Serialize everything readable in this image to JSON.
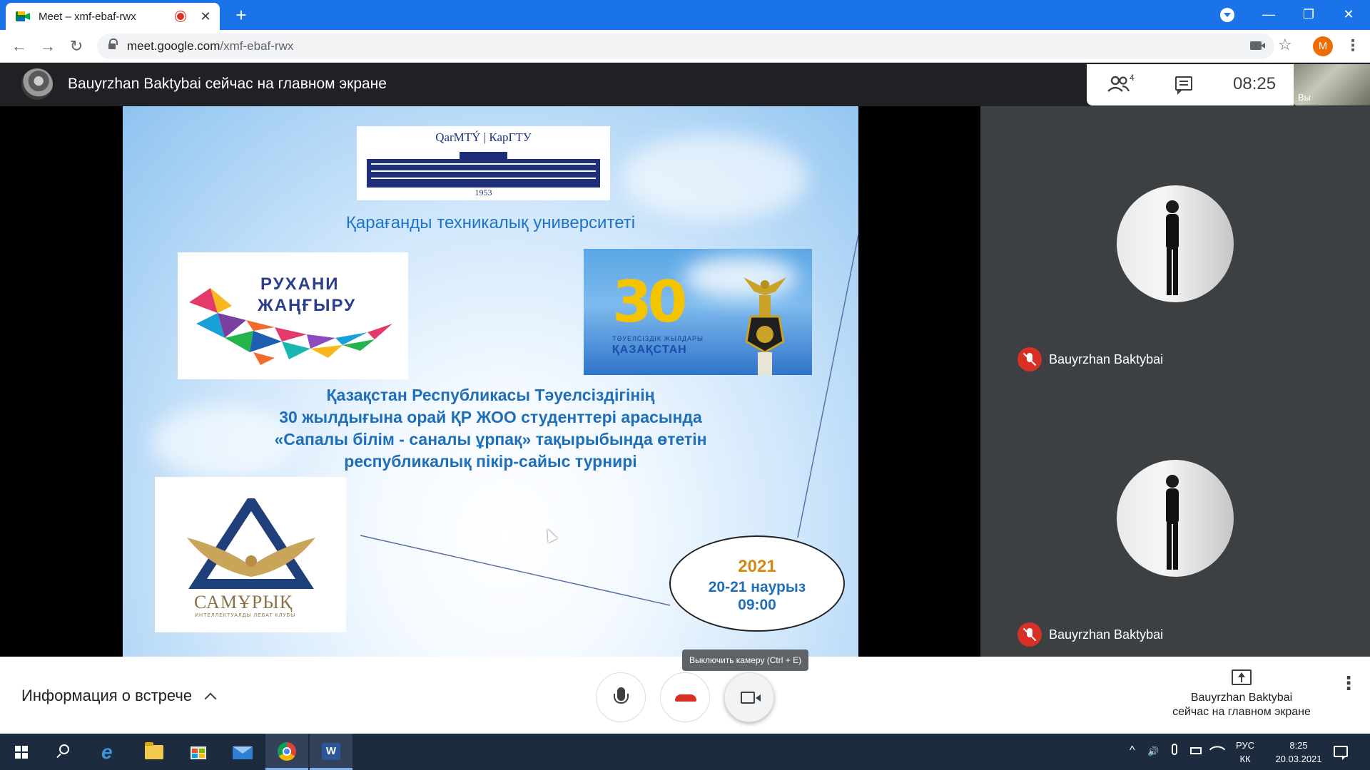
{
  "browser": {
    "tab_title": "Meet – xmf-ebaf-rwx",
    "new_tab_symbol": "+",
    "close_tab_symbol": "✕",
    "url_host": "meet.google.com",
    "url_path": "/xmf-ebaf-rwx",
    "profile_initial": "M",
    "nav": {
      "back": "←",
      "forward": "→",
      "reload": "↻"
    },
    "window": {
      "minimize": "—",
      "restore": "❐",
      "close": "✕"
    },
    "star": "☆",
    "menu": "⋮"
  },
  "header": {
    "presenter_title": "Bauyrzhan Baktybai сейчас на главном экране",
    "people_count": "4",
    "clock": "08:25",
    "self_label": "Вы"
  },
  "slide": {
    "uni_logo_text": "QarMTÝ  |  КарГТУ",
    "uni_logo_year": "1953",
    "uni_name": "Қарағанды техникалық университеті",
    "rukhani_line1": "РУХАНИ",
    "rukhani_line2": "ЖАҢҒЫРУ",
    "thirty_number": "30",
    "thirty_sub1": "ТӘУЕЛСІЗДІК ЖЫЛДАРЫ",
    "thirty_sub2": "ҚАЗАҚСТАН",
    "event_lines": [
      "Қазақстан Республикасы Тәуелсіздігінің",
      "30 жылдығына орай ҚР ЖОО студенттері арасында",
      "«Сапалы білім - саналы ұрпақ» тақырыбында өтетін",
      "республикалық пікір-сайыс турнирі"
    ],
    "samuryk_name": "САМҰРЫҚ",
    "samuryk_sub": "ИНТЕЛЛЕКТУАЛДЫ ЛЕБАТ КЛУБЫ",
    "date_year": "2021",
    "date_days": "20-21 наурыз",
    "date_time": "09:00"
  },
  "participants": [
    {
      "name": "Bauyrzhan Baktybai"
    },
    {
      "name": "Bauyrzhan Baktybai"
    }
  ],
  "bottom": {
    "meeting_info": "Информация о встрече",
    "camera_tooltip": "Выключить камеру (Ctrl + E)",
    "present_line1": "Bauyrzhan Baktybai",
    "present_line2": "сейчас на главном экране",
    "more": "⋮"
  },
  "taskbar": {
    "lang_line1": "РУС",
    "lang_line2": "КК",
    "time": "8:25",
    "date": "20.03.2021",
    "tray_up": "^",
    "tray_volume": "🔊"
  },
  "colors": {
    "chrome_blue": "#1a73e8",
    "meet_dark": "#202124",
    "tile_gray": "#3c4043",
    "hangup_red": "#d93025",
    "profile_orange": "#ef6c00",
    "taskbar": "#1d2b3e"
  }
}
